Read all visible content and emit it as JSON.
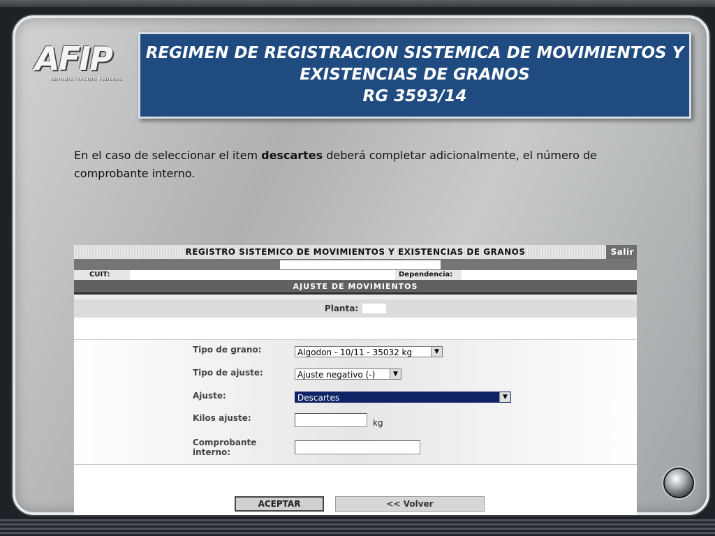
{
  "logo": {
    "mark": "AFIP",
    "sub": "ADMINISTRACION FEDERAL"
  },
  "banner": {
    "line1": "REGIMEN DE REGISTRACION SISTEMICA DE MOVIMIENTOS Y",
    "line2": "EXISTENCIAS DE GRANOS",
    "line3": "RG  3593/14"
  },
  "paragraph": {
    "before": "En el caso de seleccionar el item ",
    "bold": "descartes",
    "after": " deberá completar adicionalmente, el número de comprobante interno."
  },
  "app": {
    "title": "REGISTRO SISTEMICO DE MOVIMIENTOS Y EXISTENCIAS DE GRANOS",
    "salir": "Salir",
    "cuit_label": "CUIT:",
    "dependencia_label": "Dependencia:",
    "section_title": "AJUSTE DE MOVIMIENTOS",
    "planta_label": "Planta:",
    "fields": {
      "tipo_grano": {
        "label": "Tipo de grano:",
        "value": "Algodon - 10/11 - 35032 kg"
      },
      "tipo_ajuste": {
        "label": "Tipo de ajuste:",
        "value": "Ajuste negativo (-)"
      },
      "ajuste": {
        "label": "Ajuste:",
        "value": "Descartes"
      },
      "kilos": {
        "label": "Kilos ajuste:",
        "value": "",
        "unit": "kg"
      },
      "comprobante": {
        "label_line1": "Comprobante",
        "label_line2": "interno:",
        "value": ""
      }
    },
    "buttons": {
      "aceptar": "ACEPTAR",
      "volver": "<< Volver"
    }
  }
}
